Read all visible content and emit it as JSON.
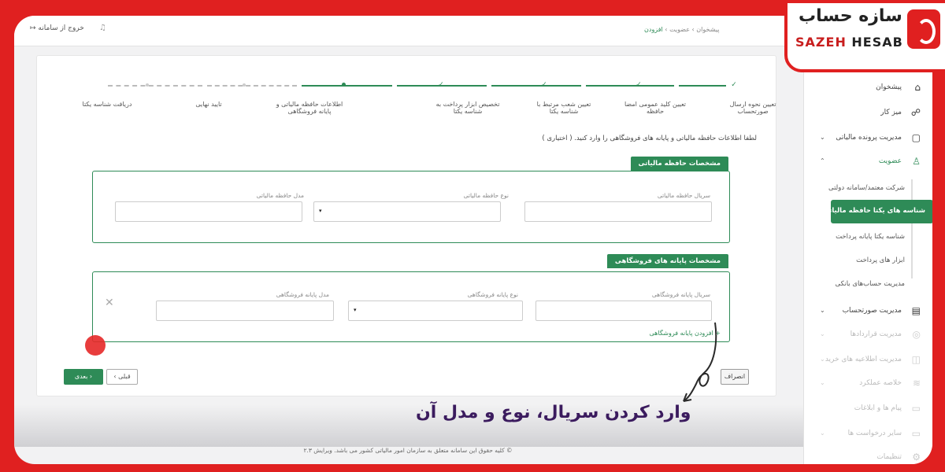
{
  "topbar": {
    "exit_label": "خروج از سامانه",
    "exit_icon": "↦",
    "bell_icon": "♫",
    "breadcrumb": [
      "پیشخوان",
      "عضویت",
      "افزودن"
    ]
  },
  "sidebar": {
    "items": [
      {
        "label": "پیشخوان",
        "icon": "⌂"
      },
      {
        "label": "میز کار",
        "icon": "☍"
      },
      {
        "label": "مدیریت پرونده مالیاتی",
        "icon": "▢",
        "chevron": "⌄"
      },
      {
        "label": "عضویت",
        "icon": "♙",
        "chevron": "⌃"
      }
    ],
    "submenu": [
      {
        "label": "شرکت معتمد/سامانه دولتی"
      },
      {
        "label": "شناسه های یکتا حافظه مالیاتی"
      },
      {
        "label": "شناسه یکتا پایانه پرداخت"
      },
      {
        "label": "ابزار های پرداخت"
      },
      {
        "label": "مدیریت حساب‌های بانکی"
      }
    ],
    "items2": [
      {
        "label": "مدیریت صورتحساب",
        "icon": "▤",
        "chevron": "⌄"
      },
      {
        "label": "مدیریت قراردادها",
        "icon": "◎",
        "chevron": "⌄"
      },
      {
        "label": "مدیریت اطلاعیه های خرید",
        "icon": "◫",
        "chevron": "⌄"
      },
      {
        "label": "خلاصه عملکرد",
        "icon": "≋",
        "chevron": "⌄"
      },
      {
        "label": "پیام ها و ابلاغات",
        "icon": "▭"
      },
      {
        "label": "سایر درخواست ها",
        "icon": "▭",
        "chevron": "⌄"
      },
      {
        "label": "تنظیمات",
        "icon": "⚙"
      }
    ]
  },
  "stepper": {
    "steps": [
      {
        "label": "تعیین نحوه ارسال صورتحساب"
      },
      {
        "label": "تعیین کلید عمومی امضا حافظه"
      },
      {
        "label": "تعیین شعب مرتبط با شناسه یکتا"
      },
      {
        "label": "تخصیص ابزار پرداخت به شناسه یکتا"
      },
      {
        "label": "اطلاعات حافظه مالیاتی و پایانه فروشگاهی"
      },
      {
        "label": "تایید نهایی"
      },
      {
        "label": "دریافت شناسه یکتا"
      }
    ],
    "check_glyph": "✓",
    "current_index": 4
  },
  "info_text": "لطفا اطلاعات حافظه مالیاتی و پایانه های فروشگاهی را وارد کنید. ( اختیاری )",
  "memory_section": {
    "title": "مشخصات حافظه مالیاتی",
    "serial_label": "سریال حافظه مالیاتی",
    "type_label": "نوع حافظه مالیاتی",
    "model_label": "مدل حافظه مالیاتی",
    "serial_value": "",
    "type_value": "",
    "model_value": "",
    "select_arrow": "▾"
  },
  "terminal_section": {
    "title": "مشخصات پایانه های فروشگاهی",
    "serial_label": "سریال پایانه فروشگاهی",
    "type_label": "نوع پایانه فروشگاهی",
    "model_label": "مدل پایانه فروشگاهی",
    "serial_value": "",
    "type_value": "",
    "model_value": "",
    "remove_glyph": "✕",
    "select_arrow": "▾"
  },
  "add_terminal_label": "+ افزودن پایانه فروشگاهی",
  "buttons": {
    "next": "بعدی ›",
    "prev": "‹ قبلی",
    "cancel": "انصراف"
  },
  "footer_text": "© کلیه حقوق این سامانه متعلق به سازمان امور مالیاتی کشور می باشد. ویرایش ۲.۳",
  "caption": "وارد کردن سریال، نوع و مدل آن",
  "logo": {
    "fa": "سازه حساب",
    "en_part1": "SAZEH",
    "en_part2": "HESAB"
  },
  "colors": {
    "accent": "#2e8b57",
    "brand_red": "#e02020",
    "caption": "#3b1b5e"
  }
}
